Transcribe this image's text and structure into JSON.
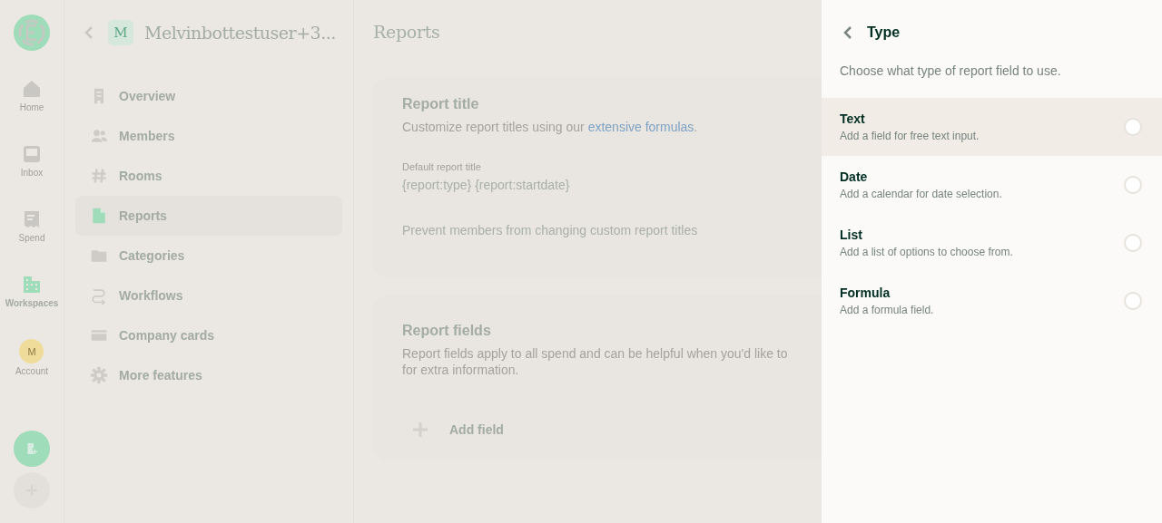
{
  "nav_rail": {
    "items": [
      {
        "label": "Home",
        "selected": false
      },
      {
        "label": "Inbox",
        "selected": false
      },
      {
        "label": "Spend",
        "selected": false
      },
      {
        "label": "Workspaces",
        "selected": true
      },
      {
        "label": "Account",
        "avatar_letter": "M",
        "selected": false
      }
    ]
  },
  "sidebar": {
    "workspace_letter": "M",
    "workspace_name": "Melvinbottestuser+3...",
    "items": [
      {
        "label": "Overview",
        "selected": false
      },
      {
        "label": "Members",
        "selected": false
      },
      {
        "label": "Rooms",
        "selected": false
      },
      {
        "label": "Reports",
        "selected": true
      },
      {
        "label": "Categories",
        "selected": false
      },
      {
        "label": "Workflows",
        "selected": false
      },
      {
        "label": "Company cards",
        "selected": false
      },
      {
        "label": "More features",
        "selected": false
      }
    ]
  },
  "main": {
    "title": "Reports",
    "report_title": {
      "heading": "Report title",
      "description": "Customize report titles using our ",
      "link": "extensive formulas",
      "description_end": ".",
      "field_label": "Default report title",
      "field_value": "{report:type} {report:startdate}",
      "prevent_label": "Prevent members from changing custom report titles"
    },
    "report_fields": {
      "heading": "Report fields",
      "description_lines": [
        "Report fields apply to all spend and can be helpful when you'd like to",
        "for extra information."
      ],
      "add_button": "Add field"
    }
  },
  "type_panel": {
    "title": "Type",
    "subtitle": "Choose what type of report field to use.",
    "options": [
      {
        "label": "Text",
        "description": "Add a field for free text input.",
        "highlighted": true,
        "selected": false
      },
      {
        "label": "Date",
        "description": "Add a calendar for date selection.",
        "highlighted": false,
        "selected": false
      },
      {
        "label": "List",
        "description": "Add a list of options to choose from.",
        "highlighted": false,
        "selected": false
      },
      {
        "label": "Formula",
        "description": "Add a formula field.",
        "highlighted": false,
        "selected": false
      }
    ]
  }
}
